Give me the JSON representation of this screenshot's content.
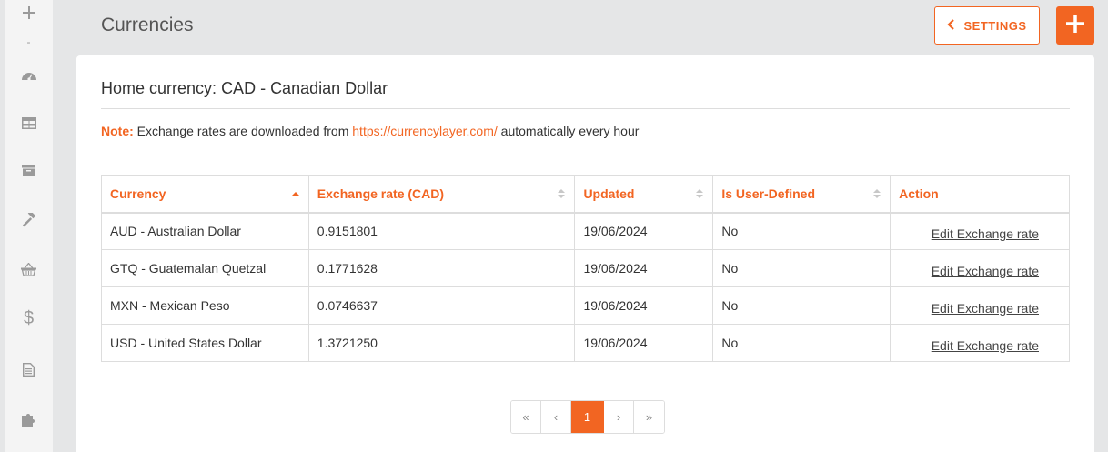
{
  "page": {
    "title": "Currencies"
  },
  "header": {
    "settings_label": "SETTINGS"
  },
  "card": {
    "home_label": "Home currency:",
    "home_value": "CAD - Canadian Dollar",
    "note_label": "Note:",
    "note_text_before": " Exchange rates are downloaded from ",
    "note_link": "https://currencylayer.com/",
    "note_text_after": " automatically every hour"
  },
  "table": {
    "columns": [
      "Currency",
      "Exchange rate (CAD)",
      "Updated",
      "Is User-Defined",
      "Action"
    ],
    "rows": [
      {
        "currency": "AUD - Australian Dollar",
        "rate": "0.9151801",
        "updated": "19/06/2024",
        "user_defined": "No",
        "action": "Edit Exchange rate"
      },
      {
        "currency": "GTQ - Guatemalan Quetzal",
        "rate": "0.1771628",
        "updated": "19/06/2024",
        "user_defined": "No",
        "action": "Edit Exchange rate"
      },
      {
        "currency": "MXN - Mexican Peso",
        "rate": "0.0746637",
        "updated": "19/06/2024",
        "user_defined": "No",
        "action": "Edit Exchange rate"
      },
      {
        "currency": "USD - United States Dollar",
        "rate": "1.3721250",
        "updated": "19/06/2024",
        "user_defined": "No",
        "action": "Edit Exchange rate"
      }
    ]
  },
  "pagination": {
    "first": "«",
    "prev": "‹",
    "current": "1",
    "next": "›",
    "last": "»"
  },
  "colors": {
    "accent": "#f26522",
    "sidebar_icon": "#9a9a9a",
    "background": "#e5e6e7"
  },
  "sidebar": {
    "icons": [
      "plus-icon",
      "dashboard-icon",
      "table-icon",
      "archive-icon",
      "hammer-icon",
      "basket-icon",
      "dollar-icon",
      "document-icon",
      "puzzle-icon"
    ],
    "dollar_glyph": "$"
  }
}
